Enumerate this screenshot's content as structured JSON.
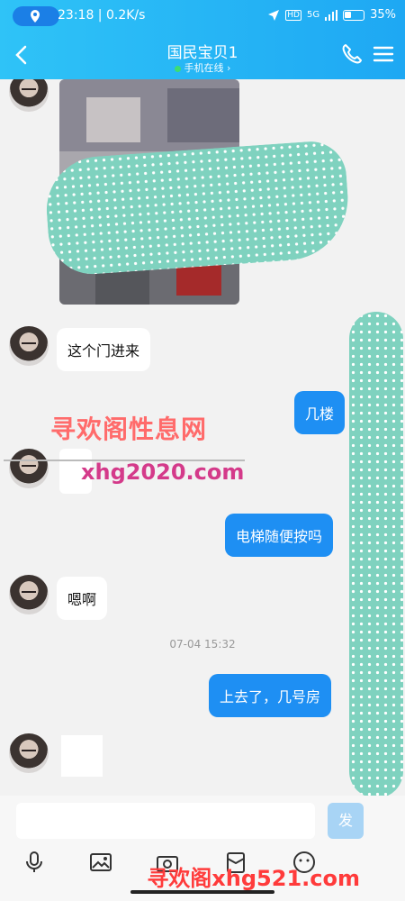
{
  "status": {
    "time": "23:18",
    "speed": "0.2K/s",
    "network": "5G",
    "battery": "35%"
  },
  "header": {
    "title": "国民宝贝1",
    "subtitle": "手机在线 ›"
  },
  "messages": [
    {
      "side": "in",
      "text": "这个门进来"
    },
    {
      "side": "out",
      "text": "几楼"
    },
    {
      "side": "out",
      "text": "电梯随便按吗"
    },
    {
      "side": "in",
      "text": "嗯啊"
    },
    {
      "side": "out",
      "text": "上去了，几号房"
    }
  ],
  "timestamp": "07-04 15:32",
  "watermarks": {
    "line1": "寻欢阁性息网",
    "line2": "xhg2020.com",
    "line3": "寻欢阁xhg521.com"
  },
  "input": {
    "send_label": "发"
  },
  "colors": {
    "header_start": "#2fc3f7",
    "header_end": "#1ea8f3",
    "outgoing_bubble": "#1e8ff3",
    "scribble": "#7fd2bf"
  }
}
